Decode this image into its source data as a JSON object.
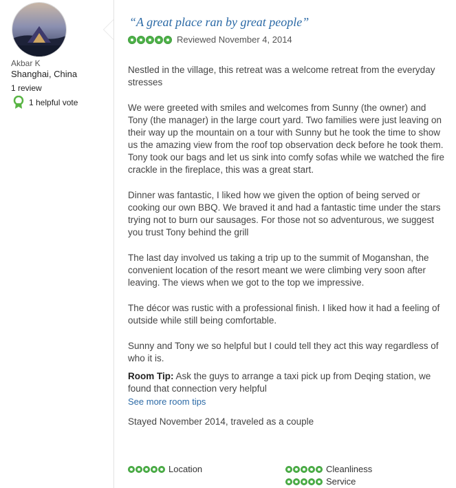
{
  "reviewer": {
    "name": "Akbar K",
    "location": "Shanghai, China",
    "review_count": "1 review",
    "helpful_votes": "1 helpful vote"
  },
  "review": {
    "title": "“A great place ran by great people”",
    "rating": 5,
    "rating_max": 5,
    "date_text": "Reviewed November 4, 2014",
    "paragraphs": [
      "Nestled in the village, this retreat was a welcome retreat from the everyday stresses",
      "We were greeted with smiles and welcomes from Sunny (the owner) and Tony (the manager) in the large court yard. Two families were just leaving on their way up the mountain on a tour with Sunny but he took the time to show us the amazing view from the roof top observation deck before he took them. Tony took our bags and let us sink into comfy sofas while we watched the fire crackle in the fireplace, this was a great start.",
      "Dinner was fantastic, I liked how we given the option of being served or cooking our own BBQ. We braved it and had a fantastic time under the stars trying not to burn our sausages. For those not so adventurous, we suggest you trust Tony behind the grill",
      "The last day involved us taking a trip up to the summit of Moganshan, the convenient location of the resort meant we were climbing very soon after leaving. The views when we got to the top we impressive.",
      "The décor was rustic with a professional finish. I liked how it had a feeling of outside while still being comfortable.",
      "Sunny and Tony we so helpful but I could tell they act this way regardless of who it is."
    ],
    "room_tip_label": "Room Tip:",
    "room_tip_text": "Ask the guys to arrange a taxi pick up from Deqing station, we found that connection very helpful",
    "more_tips_link": "See more room tips",
    "stayed": "Stayed November 2014, traveled as a couple",
    "sub_ratings": [
      {
        "label": "Location",
        "rating": 5
      },
      {
        "label": "Cleanliness",
        "rating": 5
      },
      {
        "label": "Service",
        "rating": 5
      }
    ]
  },
  "colors": {
    "title_blue": "#2c6aa6",
    "bubble_green": "#4fb34a"
  },
  "icons": [
    "avatar-photo",
    "helpful-vote-badge-icon",
    "rating-bubble-icon"
  ]
}
